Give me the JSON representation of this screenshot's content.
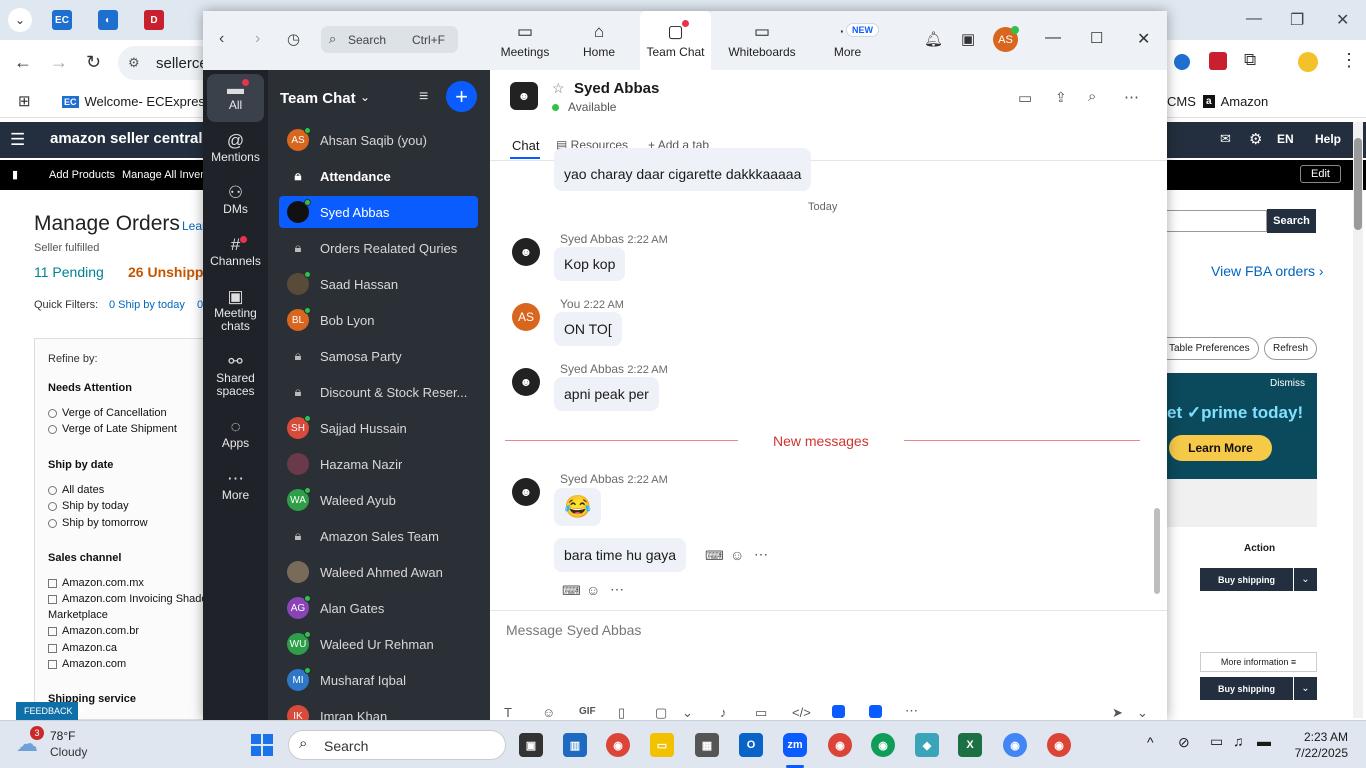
{
  "browser": {
    "address": "sellerce",
    "bookmarks": [
      "Welcome- ECExpres...",
      "CMS",
      "Amazon"
    ]
  },
  "amazon": {
    "logo": "amazon seller central",
    "nav": [
      "Add Products",
      "Manage All Invent"
    ],
    "right_nav": {
      "lang": "EN",
      "help": "Help",
      "edit": "Edit"
    },
    "page_title": "Manage Orders",
    "learn": "Lear",
    "subtitle": "Seller fulfilled",
    "tabs": {
      "pending": "11 Pending",
      "unshipped": "26 Unshippe"
    },
    "quick_filters_label": "Quick Filters:",
    "quick_filter_1": "0 Ship by today",
    "quick_filter_2": "0",
    "refine": "Refine by:",
    "needs_attention": "Needs Attention",
    "attention_items": [
      "Verge of Cancellation",
      "Verge of Late Shipment"
    ],
    "ship_by_date": "Ship by date",
    "ship_items": [
      "All dates",
      "Ship by today",
      "Ship by tomorrow"
    ],
    "sales_channel": "Sales channel",
    "channel_items": [
      "Amazon.com.mx",
      "Amazon.com Invoicing Shado",
      "Marketplace",
      "Amazon.com.br",
      "Amazon.ca",
      "Amazon.com"
    ],
    "shipping_service": "Shipping service",
    "feedback": "FEEDBACK",
    "search_btn": "Search",
    "view_fba": "View FBA orders ›",
    "table_prefs": "Table Preferences",
    "refresh": "Refresh",
    "ad": {
      "dismiss": "Dismiss",
      "text": "et ✓prime today!",
      "button": "Learn More"
    },
    "action_header": "Action",
    "buy_shipping": "Buy shipping",
    "more_info": "More information ≡"
  },
  "zoom": {
    "search": {
      "label": "Search",
      "shortcut": "Ctrl+F"
    },
    "top_tabs": [
      {
        "label": "Meetings",
        "icon": "video-icon"
      },
      {
        "label": "Home",
        "icon": "home-icon"
      },
      {
        "label": "Team Chat",
        "icon": "chat-icon"
      },
      {
        "label": "Whiteboards",
        "icon": "whiteboard-icon"
      },
      {
        "label": "More",
        "icon": "more-icon"
      }
    ],
    "new_badge": "NEW",
    "user_initials": "AS",
    "left_nav": [
      {
        "label": "All",
        "icon": "chat-bubble-icon"
      },
      {
        "label": "Mentions",
        "icon": "at-icon"
      },
      {
        "label": "DMs",
        "icon": "people-icon"
      },
      {
        "label": "Channels",
        "icon": "hash-icon"
      },
      {
        "label": "Meeting chats",
        "icon": "calendar-icon"
      },
      {
        "label": "Shared spaces",
        "icon": "share-icon"
      },
      {
        "label": "Apps",
        "icon": "apps-icon"
      },
      {
        "label": "More",
        "icon": "ellipsis-icon"
      }
    ],
    "list_title": "Team Chat",
    "chats": [
      {
        "name": "Ahsan Saqib (you)",
        "initials": "AS",
        "color": "#d9661f",
        "type": "person",
        "online": true
      },
      {
        "name": "Attendance",
        "type": "channel",
        "bold": true
      },
      {
        "name": "Syed Abbas",
        "initials": "",
        "color": "#111111",
        "type": "person",
        "online": true,
        "selected": true
      },
      {
        "name": "Orders Realated Quries",
        "type": "channel"
      },
      {
        "name": "Saad Hassan",
        "initials": "",
        "color": "#5a4a3a",
        "type": "person",
        "online": true
      },
      {
        "name": "Bob Lyon",
        "initials": "BL",
        "color": "#d9661f",
        "type": "person",
        "online": true
      },
      {
        "name": "Samosa Party",
        "type": "channel"
      },
      {
        "name": "Discount & Stock Reser...",
        "type": "channel"
      },
      {
        "name": "Sajjad Hussain",
        "initials": "SH",
        "color": "#d84a3a",
        "type": "person",
        "online": true
      },
      {
        "name": "Hazama Nazir",
        "initials": "",
        "color": "#6b3a4a",
        "type": "person",
        "online": false
      },
      {
        "name": "Waleed Ayub",
        "initials": "WA",
        "color": "#2e9e48",
        "type": "person",
        "online": true
      },
      {
        "name": "Amazon Sales Team",
        "type": "channel"
      },
      {
        "name": "Waleed Ahmed Awan",
        "initials": "",
        "color": "#7a6a5a",
        "type": "person",
        "online": false
      },
      {
        "name": "Alan Gates",
        "initials": "AG",
        "color": "#8a44b8",
        "type": "person",
        "online": true
      },
      {
        "name": "Waleed Ur Rehman",
        "initials": "WU",
        "color": "#2e9e48",
        "type": "person",
        "online": true
      },
      {
        "name": "Musharaf Iqbal",
        "initials": "MI",
        "color": "#2e76c8",
        "type": "person",
        "online": true
      },
      {
        "name": "Imran Khan",
        "initials": "IK",
        "color": "#d84a3a",
        "type": "person",
        "online": false
      }
    ],
    "contact": {
      "name": "Syed Abbas",
      "status": "Available"
    },
    "chat_tabs": {
      "chat": "Chat",
      "resources": "Resources",
      "add": "Add a tab"
    },
    "messages": {
      "prev": "yao charay daar cigarette dakkkaaaaa",
      "today": "Today",
      "m1_sender": "Syed Abbas",
      "m1_time": "2:22 AM",
      "m1_text": "Kop kop",
      "m2_sender": "You",
      "m2_time": "2:22 AM",
      "m2_text": "ON TO[",
      "m2_initials": "AS",
      "m3_sender": "Syed Abbas",
      "m3_time": "2:22 AM",
      "m3_text": "apni peak per",
      "new_messages": "New messages",
      "m4_sender": "Syed Abbas",
      "m4_time": "2:22 AM",
      "m4_emoji": "😂",
      "m4_text": "bara time hu gaya"
    },
    "composer_placeholder": "Message Syed Abbas",
    "composer_tools": {
      "gif": "GIF"
    }
  },
  "taskbar": {
    "weather": {
      "temp": "78°F",
      "desc": "Cloudy",
      "badge": "3"
    },
    "search": "Search",
    "time": "2:23 AM",
    "date": "7/22/2025"
  },
  "colors": {
    "zoom_blue": "#0b5cff",
    "dark_nav": "#1f2329",
    "list_bg": "#2b2f36",
    "new_msg": "#d0352e",
    "amazon_dark": "#232f3e"
  }
}
